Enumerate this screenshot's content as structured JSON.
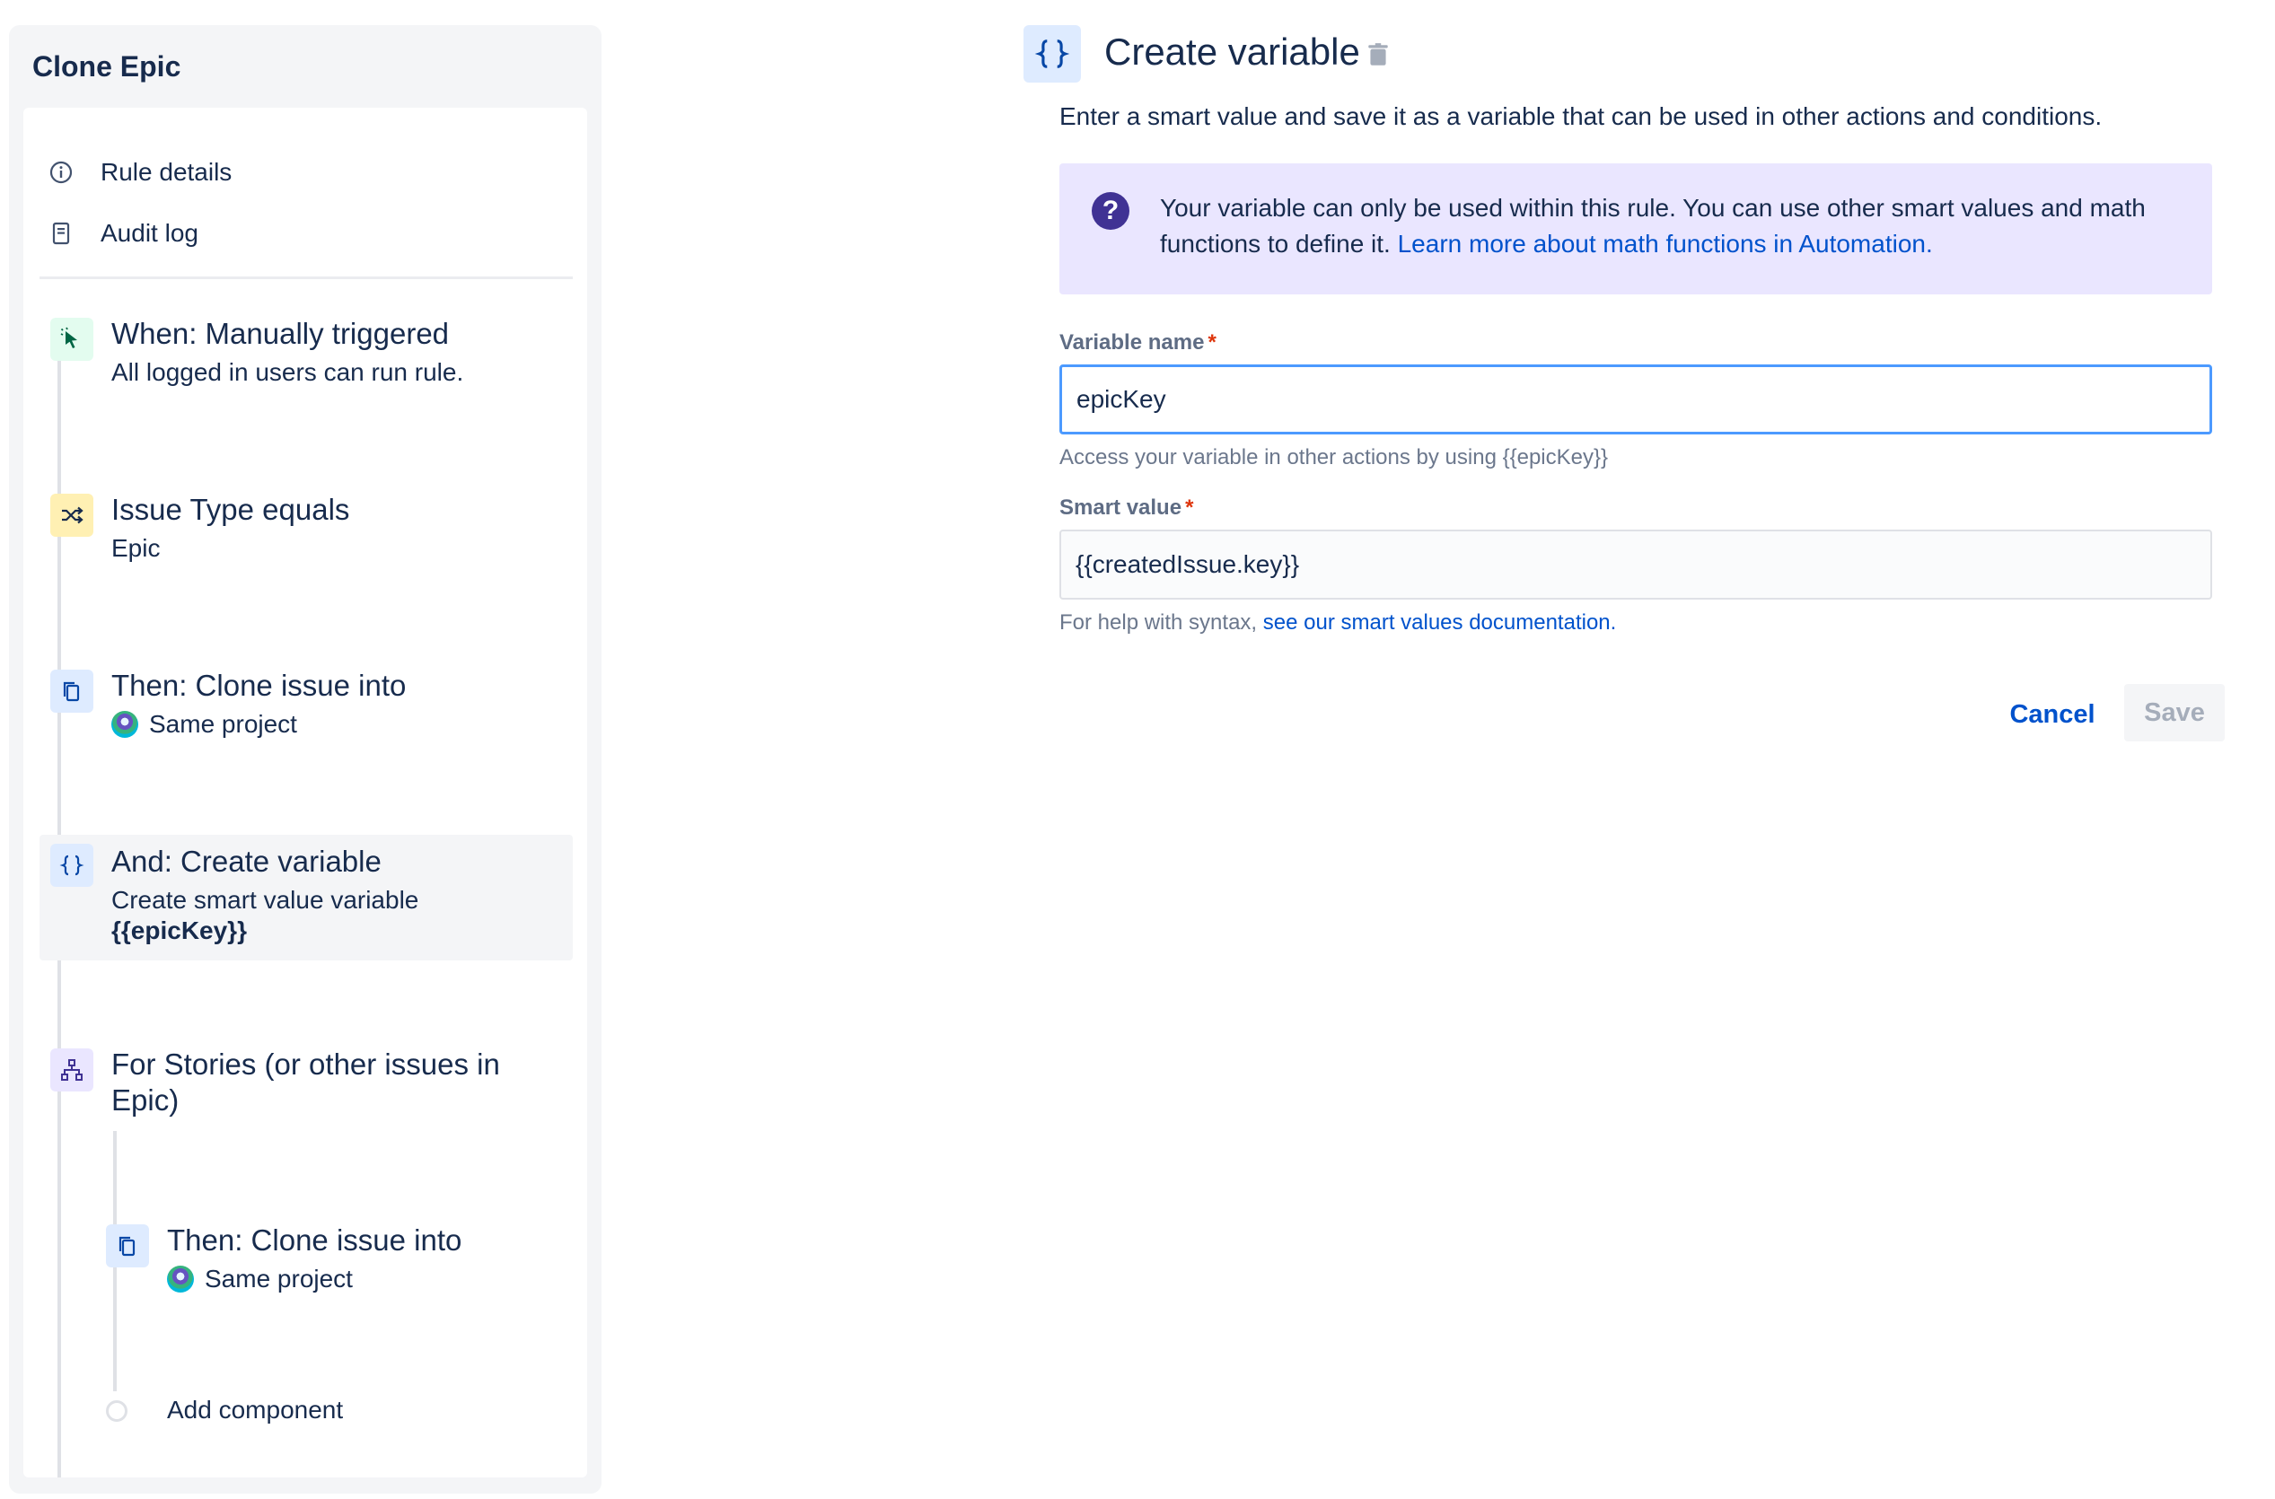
{
  "rule": {
    "title": "Clone Epic",
    "menu": [
      {
        "label": "Rule details",
        "icon": "info-icon"
      },
      {
        "label": "Audit log",
        "icon": "document-icon"
      }
    ],
    "steps": [
      {
        "title": "When: Manually triggered",
        "subtitle": "All logged in users can run rule.",
        "icon": "cursor-click-icon",
        "icon_bg": "#e3fcef",
        "icon_color": "#006644"
      },
      {
        "title": "Issue Type equals",
        "subtitle": "Epic",
        "icon": "shuffle-icon",
        "icon_bg": "#fff0b3",
        "icon_color": "#172b4d"
      },
      {
        "title": "Then: Clone issue into",
        "subtitle": "Same project",
        "icon": "copy-icon",
        "icon_bg": "#deebff",
        "icon_color": "#0747a6"
      },
      {
        "title": "And: Create variable",
        "subtitle": "Create smart value variable",
        "subtitle_bold": "{{epicKey}}",
        "icon": "braces-icon",
        "icon_bg": "#deebff",
        "icon_color": "#0747a6",
        "selected": true
      },
      {
        "title_line1": "For Stories (or other issues in",
        "title_line2": "Epic)",
        "icon": "hierarchy-icon",
        "icon_bg": "#eae6ff",
        "icon_color": "#403294"
      },
      {
        "title": "Then: Clone issue into",
        "subtitle": "Same project",
        "icon": "copy-icon",
        "icon_bg": "#deebff",
        "icon_color": "#0747a6",
        "nested": true
      }
    ],
    "add_component": "Add component"
  },
  "form": {
    "title": "Create variable",
    "description": "Enter a smart value and save it as a variable that can be used in other actions and conditions.",
    "info": {
      "text": "Your variable can only be used within this rule. You can use other smart values and math functions to define it. ",
      "link": "Learn more about math functions in Automation.",
      "icon": "question-icon"
    },
    "variable_name": {
      "label": "Variable name",
      "required": "*",
      "value": "epicKey",
      "help": "Access your variable in other actions by using {{epicKey}}"
    },
    "smart_value": {
      "label": "Smart value",
      "required": "*",
      "value": "{{createdIssue.key}}",
      "help_prefix": "For help with syntax, ",
      "help_link": "see our smart values documentation."
    },
    "cancel_label": "Cancel",
    "save_label": "Save"
  },
  "colors": {
    "accent": "#0052cc",
    "focus_border": "#4c9aff",
    "info_bg": "#eae6ff",
    "required": "#de350b"
  }
}
